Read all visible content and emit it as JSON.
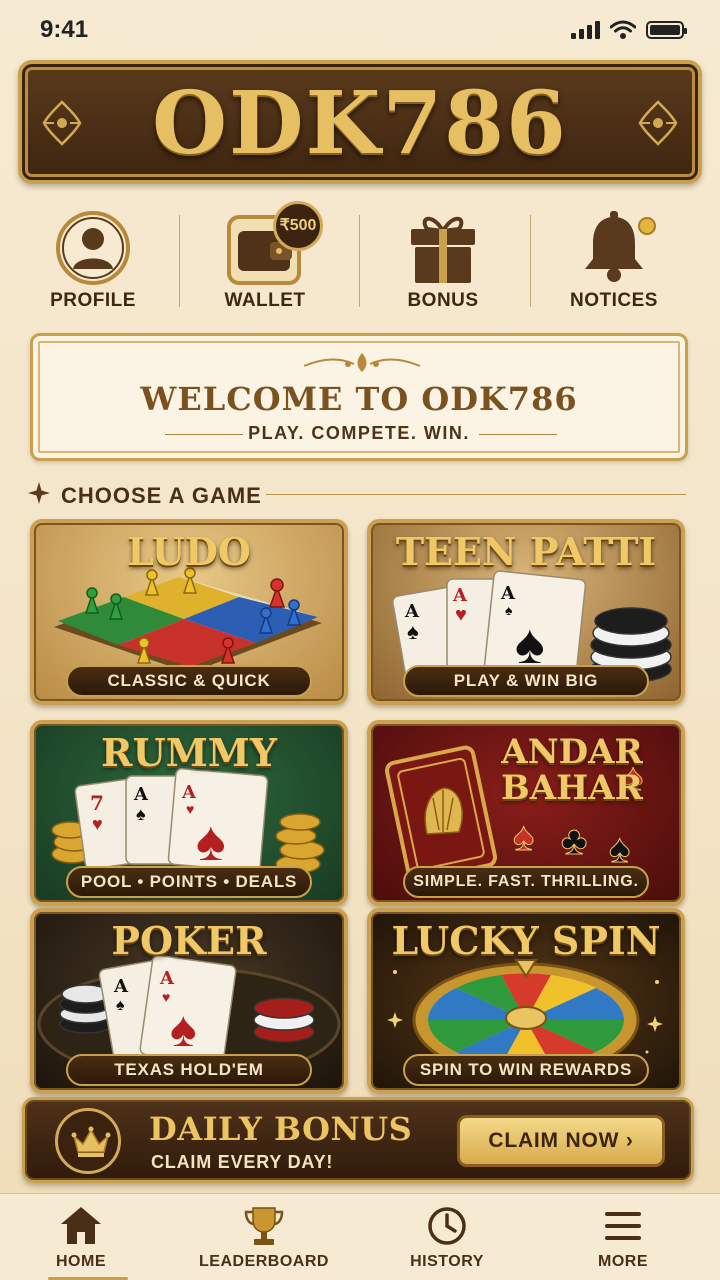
{
  "status_bar": {
    "time": "9:41"
  },
  "brand": {
    "title": "ODK786"
  },
  "quick_nav": [
    {
      "label": "PROFILE",
      "icon": "user-icon"
    },
    {
      "label": "WALLET",
      "icon": "wallet-icon",
      "badge": "₹500"
    },
    {
      "label": "BONUS",
      "icon": "gift-icon"
    },
    {
      "label": "NOTICES",
      "icon": "bell-icon"
    }
  ],
  "welcome": {
    "title": "WELCOME TO ODK786",
    "subtitle": "PLAY. COMPETE. WIN."
  },
  "section": {
    "title": "CHOOSE A GAME"
  },
  "games": [
    {
      "title": "LUDO",
      "caption": "CLASSIC & QUICK"
    },
    {
      "title": "TEEN PATTI",
      "caption": "PLAY & WIN BIG"
    },
    {
      "title": "RUMMY",
      "caption": "POOL • POINTS • DEALS"
    },
    {
      "title": "ANDAR BAHAR",
      "caption": "SIMPLE. FAST. THRILLING."
    },
    {
      "title": "POKER",
      "caption": "TEXAS HOLD'EM"
    },
    {
      "title": "LUCKY SPIN",
      "caption": "SPIN TO WIN REWARDS"
    }
  ],
  "daily_bonus": {
    "title": "DAILY BONUS",
    "subtitle": "CLAIM EVERY DAY!",
    "button": "CLAIM NOW ›"
  },
  "bottom_nav": [
    {
      "label": "HOME",
      "icon": "home-icon",
      "active": true
    },
    {
      "label": "LEADERBOARD",
      "icon": "trophy-icon"
    },
    {
      "label": "HISTORY",
      "icon": "clock-icon"
    },
    {
      "label": "MORE",
      "icon": "menu-icon"
    }
  ],
  "colors": {
    "gold": "#c9a04c",
    "brown": "#3e2510",
    "cream": "#f6ead2"
  }
}
